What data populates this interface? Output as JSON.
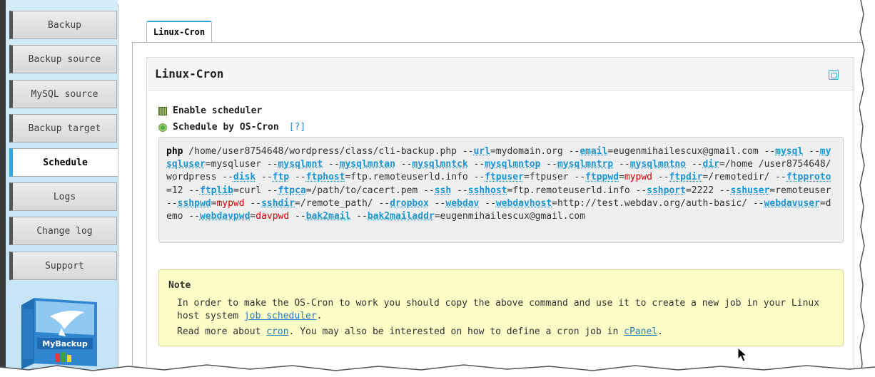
{
  "sidebar": {
    "items": [
      {
        "label": "Backup"
      },
      {
        "label": "Backup source"
      },
      {
        "label": "MySQL source"
      },
      {
        "label": "Backup target"
      },
      {
        "label": "Schedule",
        "active": true
      },
      {
        "label": "Logs"
      },
      {
        "label": "Change log"
      },
      {
        "label": "Support"
      }
    ],
    "logo_text": "MyBackup"
  },
  "tab": {
    "label": "Linux-Cron"
  },
  "panel": {
    "title": "Linux-Cron",
    "enable_scheduler_label": "Enable scheduler",
    "schedule_by_label": "Schedule by OS-Cron",
    "help_link": "[?]"
  },
  "command": {
    "parts": [
      {
        "t": "php",
        "c": "kw"
      },
      {
        "t": " /home/user8754648/wordpress/class/cli-backup.php --"
      },
      {
        "t": "url",
        "c": "opt"
      },
      {
        "t": "=mydomain.org --"
      },
      {
        "t": "email",
        "c": "opt"
      },
      {
        "t": "=eugenmihailescux@gmail.com --"
      },
      {
        "t": "mysql",
        "c": "opt"
      },
      {
        "t": " --"
      },
      {
        "t": "mysqluser",
        "c": "opt"
      },
      {
        "t": "=mysqluser --"
      },
      {
        "t": "mysqlmnt",
        "c": "opt"
      },
      {
        "t": " --"
      },
      {
        "t": "mysqlmntan",
        "c": "opt"
      },
      {
        "t": " --"
      },
      {
        "t": "mysqlmntck",
        "c": "opt"
      },
      {
        "t": " --"
      },
      {
        "t": "mysqlmntop",
        "c": "opt"
      },
      {
        "t": " --"
      },
      {
        "t": "mysqlmntrp",
        "c": "opt"
      },
      {
        "t": " --"
      },
      {
        "t": "mysqlmntno",
        "c": "opt"
      },
      {
        "t": " --"
      },
      {
        "t": "dir",
        "c": "opt"
      },
      {
        "t": "=/home /user8754648/wordpress --"
      },
      {
        "t": "disk",
        "c": "opt"
      },
      {
        "t": " --"
      },
      {
        "t": "ftp",
        "c": "opt"
      },
      {
        "t": " --"
      },
      {
        "t": "ftphost",
        "c": "opt"
      },
      {
        "t": "=ftp.remoteuserld.info --"
      },
      {
        "t": "ftpuser",
        "c": "opt"
      },
      {
        "t": "=ftpuser --"
      },
      {
        "t": "ftppwd",
        "c": "opt"
      },
      {
        "t": "="
      },
      {
        "t": "mypwd",
        "c": "red"
      },
      {
        "t": " --"
      },
      {
        "t": "ftpdir",
        "c": "opt"
      },
      {
        "t": "=/remotedir/ --"
      },
      {
        "t": "ftpproto",
        "c": "opt"
      },
      {
        "t": "=12 --"
      },
      {
        "t": "ftplib",
        "c": "opt"
      },
      {
        "t": "=curl --"
      },
      {
        "t": "ftpca",
        "c": "opt"
      },
      {
        "t": "=/path/to/cacert.pem --"
      },
      {
        "t": "ssh",
        "c": "opt"
      },
      {
        "t": " --"
      },
      {
        "t": "sshhost",
        "c": "opt"
      },
      {
        "t": "=ftp.remoteuserld.info --"
      },
      {
        "t": "sshport",
        "c": "opt"
      },
      {
        "t": "=2222 --"
      },
      {
        "t": "sshuser",
        "c": "opt"
      },
      {
        "t": "=remoteuser --"
      },
      {
        "t": "sshpwd",
        "c": "opt"
      },
      {
        "t": "="
      },
      {
        "t": "mypwd",
        "c": "red"
      },
      {
        "t": " --"
      },
      {
        "t": "sshdir",
        "c": "opt"
      },
      {
        "t": "=/remote_path/ --"
      },
      {
        "t": "dropbox",
        "c": "opt"
      },
      {
        "t": " --"
      },
      {
        "t": "webdav",
        "c": "opt"
      },
      {
        "t": " --"
      },
      {
        "t": "webdavhost",
        "c": "opt"
      },
      {
        "t": "=http://test.webdav.org/auth-basic/ --"
      },
      {
        "t": "webdavuser",
        "c": "opt"
      },
      {
        "t": "=demo --"
      },
      {
        "t": "webdavpwd",
        "c": "opt"
      },
      {
        "t": "="
      },
      {
        "t": "davpwd",
        "c": "red"
      },
      {
        "t": " --"
      },
      {
        "t": "bak2mail",
        "c": "opt"
      },
      {
        "t": " --"
      },
      {
        "t": "bak2mailaddr",
        "c": "opt"
      },
      {
        "t": "=eugenmihailescux@gmail.com"
      }
    ]
  },
  "note": {
    "title": "Note",
    "line1_text": "In order to make the OS-Cron to work you should copy the above command and use it to create a new job in your Linux host system ",
    "line1_link": "job scheduler",
    "line1_end": ".",
    "line2_a": "Read more about ",
    "line2_link1": "cron",
    "line2_b": ". You may also be interested on how to define a cron job in ",
    "line2_link2": "cPanel",
    "line2_end": "."
  },
  "colors": {
    "accent": "#2fa6dd",
    "option": "#1c95d5",
    "secret": "#d40000",
    "note_bg": "#fdfdc8"
  }
}
